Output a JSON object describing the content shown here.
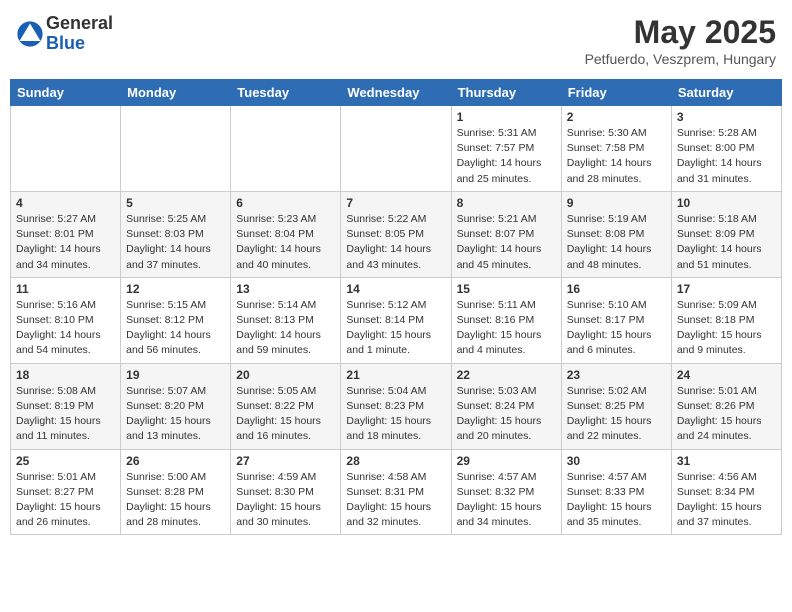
{
  "header": {
    "logo_general": "General",
    "logo_blue": "Blue",
    "title": "May 2025",
    "location": "Petfuerdo, Veszprem, Hungary"
  },
  "days_of_week": [
    "Sunday",
    "Monday",
    "Tuesday",
    "Wednesday",
    "Thursday",
    "Friday",
    "Saturday"
  ],
  "weeks": [
    [
      {
        "day": "",
        "info": ""
      },
      {
        "day": "",
        "info": ""
      },
      {
        "day": "",
        "info": ""
      },
      {
        "day": "",
        "info": ""
      },
      {
        "day": "1",
        "info": "Sunrise: 5:31 AM\nSunset: 7:57 PM\nDaylight: 14 hours\nand 25 minutes."
      },
      {
        "day": "2",
        "info": "Sunrise: 5:30 AM\nSunset: 7:58 PM\nDaylight: 14 hours\nand 28 minutes."
      },
      {
        "day": "3",
        "info": "Sunrise: 5:28 AM\nSunset: 8:00 PM\nDaylight: 14 hours\nand 31 minutes."
      }
    ],
    [
      {
        "day": "4",
        "info": "Sunrise: 5:27 AM\nSunset: 8:01 PM\nDaylight: 14 hours\nand 34 minutes."
      },
      {
        "day": "5",
        "info": "Sunrise: 5:25 AM\nSunset: 8:03 PM\nDaylight: 14 hours\nand 37 minutes."
      },
      {
        "day": "6",
        "info": "Sunrise: 5:23 AM\nSunset: 8:04 PM\nDaylight: 14 hours\nand 40 minutes."
      },
      {
        "day": "7",
        "info": "Sunrise: 5:22 AM\nSunset: 8:05 PM\nDaylight: 14 hours\nand 43 minutes."
      },
      {
        "day": "8",
        "info": "Sunrise: 5:21 AM\nSunset: 8:07 PM\nDaylight: 14 hours\nand 45 minutes."
      },
      {
        "day": "9",
        "info": "Sunrise: 5:19 AM\nSunset: 8:08 PM\nDaylight: 14 hours\nand 48 minutes."
      },
      {
        "day": "10",
        "info": "Sunrise: 5:18 AM\nSunset: 8:09 PM\nDaylight: 14 hours\nand 51 minutes."
      }
    ],
    [
      {
        "day": "11",
        "info": "Sunrise: 5:16 AM\nSunset: 8:10 PM\nDaylight: 14 hours\nand 54 minutes."
      },
      {
        "day": "12",
        "info": "Sunrise: 5:15 AM\nSunset: 8:12 PM\nDaylight: 14 hours\nand 56 minutes."
      },
      {
        "day": "13",
        "info": "Sunrise: 5:14 AM\nSunset: 8:13 PM\nDaylight: 14 hours\nand 59 minutes."
      },
      {
        "day": "14",
        "info": "Sunrise: 5:12 AM\nSunset: 8:14 PM\nDaylight: 15 hours\nand 1 minute."
      },
      {
        "day": "15",
        "info": "Sunrise: 5:11 AM\nSunset: 8:16 PM\nDaylight: 15 hours\nand 4 minutes."
      },
      {
        "day": "16",
        "info": "Sunrise: 5:10 AM\nSunset: 8:17 PM\nDaylight: 15 hours\nand 6 minutes."
      },
      {
        "day": "17",
        "info": "Sunrise: 5:09 AM\nSunset: 8:18 PM\nDaylight: 15 hours\nand 9 minutes."
      }
    ],
    [
      {
        "day": "18",
        "info": "Sunrise: 5:08 AM\nSunset: 8:19 PM\nDaylight: 15 hours\nand 11 minutes."
      },
      {
        "day": "19",
        "info": "Sunrise: 5:07 AM\nSunset: 8:20 PM\nDaylight: 15 hours\nand 13 minutes."
      },
      {
        "day": "20",
        "info": "Sunrise: 5:05 AM\nSunset: 8:22 PM\nDaylight: 15 hours\nand 16 minutes."
      },
      {
        "day": "21",
        "info": "Sunrise: 5:04 AM\nSunset: 8:23 PM\nDaylight: 15 hours\nand 18 minutes."
      },
      {
        "day": "22",
        "info": "Sunrise: 5:03 AM\nSunset: 8:24 PM\nDaylight: 15 hours\nand 20 minutes."
      },
      {
        "day": "23",
        "info": "Sunrise: 5:02 AM\nSunset: 8:25 PM\nDaylight: 15 hours\nand 22 minutes."
      },
      {
        "day": "24",
        "info": "Sunrise: 5:01 AM\nSunset: 8:26 PM\nDaylight: 15 hours\nand 24 minutes."
      }
    ],
    [
      {
        "day": "25",
        "info": "Sunrise: 5:01 AM\nSunset: 8:27 PM\nDaylight: 15 hours\nand 26 minutes."
      },
      {
        "day": "26",
        "info": "Sunrise: 5:00 AM\nSunset: 8:28 PM\nDaylight: 15 hours\nand 28 minutes."
      },
      {
        "day": "27",
        "info": "Sunrise: 4:59 AM\nSunset: 8:30 PM\nDaylight: 15 hours\nand 30 minutes."
      },
      {
        "day": "28",
        "info": "Sunrise: 4:58 AM\nSunset: 8:31 PM\nDaylight: 15 hours\nand 32 minutes."
      },
      {
        "day": "29",
        "info": "Sunrise: 4:57 AM\nSunset: 8:32 PM\nDaylight: 15 hours\nand 34 minutes."
      },
      {
        "day": "30",
        "info": "Sunrise: 4:57 AM\nSunset: 8:33 PM\nDaylight: 15 hours\nand 35 minutes."
      },
      {
        "day": "31",
        "info": "Sunrise: 4:56 AM\nSunset: 8:34 PM\nDaylight: 15 hours\nand 37 minutes."
      }
    ]
  ]
}
